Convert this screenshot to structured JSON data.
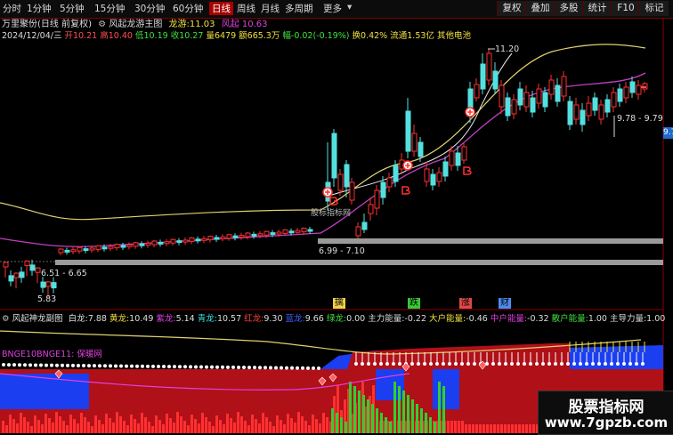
{
  "toolbar": {
    "periods": [
      "分时",
      "1分钟",
      "5分钟",
      "15分钟",
      "30分钟",
      "60分钟",
      "日线",
      "周线",
      "月线",
      "多周期",
      "更多"
    ],
    "active_period": "日线",
    "buttons": [
      "复权",
      "叠加",
      "多股",
      "统计",
      "F10",
      "标记"
    ]
  },
  "header": {
    "stock": "万里聚份(日线 前复权)",
    "indicator": "风起龙游主图",
    "dragon_label": "龙游:",
    "dragon_value": "11.03",
    "wind_label": "风起",
    "wind_value": "10.63"
  },
  "quote": {
    "date": "2024/12/04/三",
    "open": "开10.21",
    "high": "高10.40",
    "low": "低10.19",
    "close": "收10.27",
    "volume": "量6479",
    "amount": "额665.3万",
    "change": "幅-0.02(-0.19%)",
    "turnover": "换0.42%",
    "float": "流通1.53亿",
    "sector": "其他电池"
  },
  "price_labels": {
    "high_mark": "11.20",
    "range_right": "9.78 - 9.79",
    "range_mid": "6.99 - 7.10",
    "range_left": "6.51 - 6.65",
    "low_mark": "5.83",
    "watermark_center": "股标指标网",
    "right_price": "9.7"
  },
  "signals": [
    {
      "text": "擒",
      "color": "#f0d048"
    },
    {
      "text": "跌",
      "color": "#38c838"
    },
    {
      "text": "涨",
      "color": "#e04848"
    },
    {
      "text": "财",
      "color": "#4c8cf0"
    }
  ],
  "sub_header": {
    "title": "风起神龙副图",
    "items": [
      {
        "label": "白龙:",
        "value": "7.88",
        "lc": "#dddddd"
      },
      {
        "label": "黄龙:",
        "value": "10.49",
        "lc": "#f0e040"
      },
      {
        "label": "紫龙:",
        "value": "5.14",
        "lc": "#e040e0"
      },
      {
        "label": "青龙:",
        "value": "10.57",
        "lc": "#40e0e0"
      },
      {
        "label": "红龙:",
        "value": "9.30",
        "lc": "#ff4040"
      },
      {
        "label": "蓝龙:",
        "value": "9.66",
        "lc": "#4060ff"
      },
      {
        "label": "绿龙:",
        "value": "0.00",
        "lc": "#40e040"
      },
      {
        "label": "主力能量:",
        "value": "-0.22",
        "lc": "#dddddd"
      },
      {
        "label": "大户能量:",
        "value": "-0.46",
        "lc": "#f0e040"
      },
      {
        "label": "中户能量:",
        "value": "-0.32",
        "lc": "#e040e0"
      },
      {
        "label": "散户能量:",
        "value": "1.00",
        "lc": "#40e040"
      },
      {
        "label": "主导力量:",
        "value": "1.00",
        "lc": "#dddddd"
      }
    ]
  },
  "sub_labels": {
    "bnge": "BNGE10BNGE11: 保暖网"
  },
  "watermark": {
    "line1": "股票指标网",
    "line2": "www.7gpzb.com"
  },
  "colors": {
    "up": "#ff3030",
    "down": "#54e0e0",
    "avg_yellow": "#e0d070",
    "avg_purple": "#c040c0",
    "grey_band": "#9a9a9a"
  }
}
